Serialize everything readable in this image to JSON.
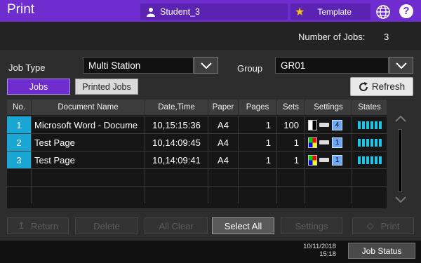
{
  "app": {
    "title": "Print"
  },
  "header": {
    "user": "Student_3",
    "template_label": "Template"
  },
  "summary": {
    "jobs_label": "Number of Jobs:",
    "jobs_value": "3"
  },
  "filters": {
    "job_type_label": "Job Type",
    "job_type_value": "Multi Station",
    "group_label": "Group",
    "group_value": "GR01"
  },
  "tabs": [
    {
      "label": "Jobs",
      "active": true
    },
    {
      "label": "Printed Jobs",
      "active": false
    }
  ],
  "refresh_label": "Refresh",
  "table": {
    "headers": [
      "No.",
      "Document Name",
      "Date,Time",
      "Paper",
      "Pages",
      "Sets",
      "Settings",
      "States"
    ],
    "rows": [
      {
        "no": "1",
        "name": "Microsoft Word - Docume",
        "datetime": "10,15:15:36",
        "paper": "A4",
        "pages": "1",
        "sets": "100",
        "copies": "4",
        "color": false
      },
      {
        "no": "2",
        "name": "Test Page",
        "datetime": "10,14:09:45",
        "paper": "A4",
        "pages": "1",
        "sets": "1",
        "copies": "1",
        "color": true
      },
      {
        "no": "3",
        "name": "Test Page",
        "datetime": "10,14:09:41",
        "paper": "A4",
        "pages": "1",
        "sets": "1",
        "copies": "1",
        "color": true
      }
    ]
  },
  "actions": {
    "return": "Return",
    "delete": "Delete",
    "all_clear": "All Clear",
    "select_all": "Select All",
    "settings": "Settings",
    "print": "Print"
  },
  "footer": {
    "date": "10/11/2018",
    "time": "15:18",
    "job_status": "Job Status"
  },
  "colors": {
    "accent": "#6f2dd0",
    "row_number": "#1aa7d6",
    "state_bars": "#1fc3e6"
  }
}
